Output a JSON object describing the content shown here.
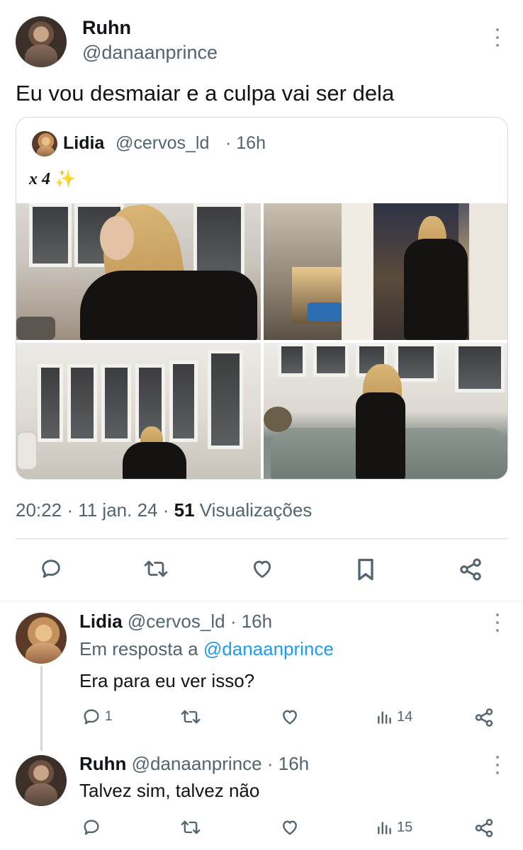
{
  "main_tweet": {
    "author_name": "Ruhn",
    "author_handle": "@danaanprince",
    "text": "Eu vou desmaiar e a culpa vai ser dela",
    "quoted": {
      "author_name": "Lidia",
      "author_handle": "@cervos_ld",
      "time": "· 16h",
      "text": "x 4",
      "emoji": "✨",
      "photo_count": 4
    },
    "meta": {
      "time": "20:22",
      "sep1": "·",
      "date": "11 jan. 24",
      "sep2": "·",
      "views_count": "51",
      "views_label": "Visualizações"
    }
  },
  "replies": [
    {
      "author_name": "Lidia",
      "author_handle": "@cervos_ld",
      "time": "· 16h",
      "reply_prefix": "Em resposta a",
      "reply_to": "@danaanprince",
      "text": "Era para eu ver isso?",
      "reply_count": "1",
      "retweet_count": "",
      "like_count": "",
      "views_count": "14"
    },
    {
      "author_name": "Ruhn",
      "author_handle": "@danaanprince",
      "time": "· 16h",
      "text": "Talvez sim, talvez não",
      "reply_count": "",
      "retweet_count": "",
      "like_count": "",
      "views_count": "15"
    }
  ],
  "colors": {
    "text": "#0f1419",
    "muted": "#536471",
    "link": "#1d9bf0",
    "border": "#cfd9de"
  },
  "icons": [
    "reply-icon",
    "retweet-icon",
    "like-icon",
    "bookmark-icon",
    "share-icon",
    "views-icon",
    "more-icon"
  ]
}
